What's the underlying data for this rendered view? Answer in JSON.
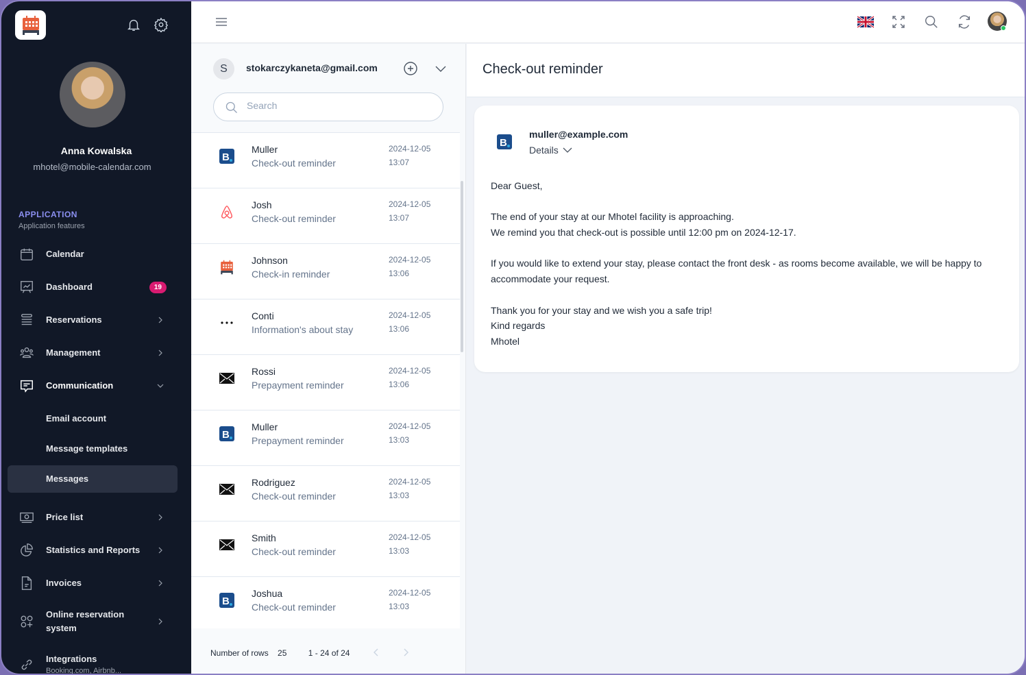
{
  "sidebar": {
    "user_name": "Anna Kowalska",
    "user_email": "mhotel@mobile-calendar.com",
    "section_title": "APPLICATION",
    "section_subtitle": "Application features",
    "items": [
      {
        "label": "Calendar",
        "icon": "calendar-icon"
      },
      {
        "label": "Dashboard",
        "icon": "dashboard-icon",
        "badge": "19"
      },
      {
        "label": "Reservations",
        "icon": "list-icon"
      },
      {
        "label": "Management",
        "icon": "people-icon"
      },
      {
        "label": "Communication",
        "icon": "chat-icon"
      },
      {
        "label": "Email account"
      },
      {
        "label": "Message templates"
      },
      {
        "label": "Messages"
      },
      {
        "label": "Price list",
        "icon": "money-icon"
      },
      {
        "label": "Statistics and Reports",
        "icon": "pie-chart-icon"
      },
      {
        "label": "Invoices",
        "icon": "document-icon"
      },
      {
        "label": "Online reservation system",
        "icon": "apps-icon"
      },
      {
        "label": "Integrations",
        "sublabel": "Booking.com, Airbnb...",
        "icon": "link-icon"
      }
    ],
    "badge_color": "#d81b71",
    "accent_color": "#8b8ff0"
  },
  "list": {
    "account_initial": "S",
    "account_email": "stokarczykaneta@gmail.com",
    "search_placeholder": "Search",
    "messages": [
      {
        "name": "Muller",
        "subject": "Check-out reminder",
        "date": "2024-12-05",
        "time": "13:07",
        "source": "booking"
      },
      {
        "name": "Josh",
        "subject": "Check-out reminder",
        "date": "2024-12-05",
        "time": "13:07",
        "source": "airbnb"
      },
      {
        "name": "Johnson",
        "subject": "Check-in reminder",
        "date": "2024-12-05",
        "time": "13:06",
        "source": "calendar"
      },
      {
        "name": "Conti",
        "subject": "Information's about stay",
        "date": "2024-12-05",
        "time": "13:06",
        "source": "other"
      },
      {
        "name": "Rossi",
        "subject": "Prepayment reminder",
        "date": "2024-12-05",
        "time": "13:06",
        "source": "email"
      },
      {
        "name": "Muller",
        "subject": "Prepayment reminder",
        "date": "2024-12-05",
        "time": "13:03",
        "source": "booking"
      },
      {
        "name": "Rodriguez",
        "subject": "Check-out reminder",
        "date": "2024-12-05",
        "time": "13:03",
        "source": "email"
      },
      {
        "name": "Smith",
        "subject": "Check-out reminder",
        "date": "2024-12-05",
        "time": "13:03",
        "source": "email"
      },
      {
        "name": "Joshua",
        "subject": "Check-out reminder",
        "date": "2024-12-05",
        "time": "13:03",
        "source": "booking"
      }
    ],
    "pager": {
      "rows_label": "Number of rows",
      "rows_value": "25",
      "range": "1 - 24 of 24"
    }
  },
  "detail": {
    "title": "Check-out reminder",
    "sender": "muller@example.com",
    "details_label": "Details",
    "body": {
      "greeting": "Dear Guest,",
      "line1": "The end of your stay at our Mhotel facility is approaching.",
      "line2": "We remind you that check-out is possible until 12:00 pm on 2024-12-17.",
      "line3": "If you would like to extend your stay, please contact the front desk - as rooms become available, we will be happy to accommodate your request.",
      "line4": "Thank you for your stay and we wish you a safe trip!",
      "line5": "Kind regards",
      "line6": "Mhotel"
    }
  }
}
